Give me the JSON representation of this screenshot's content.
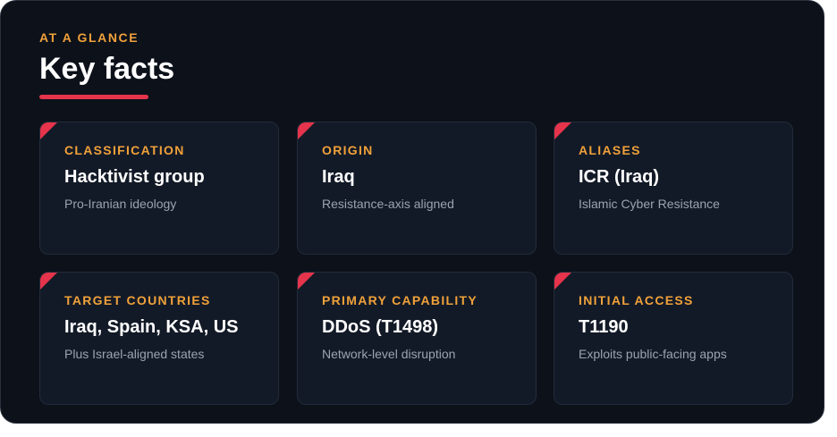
{
  "header": {
    "eyebrow": "AT A GLANCE",
    "title": "Key facts"
  },
  "colors": {
    "accent_orange": "#f0a13a",
    "accent_red": "#e5344b",
    "background": "#0c111a",
    "card": "#131a27"
  },
  "cards": [
    {
      "label": "CLASSIFICATION",
      "value": "Hacktivist group",
      "sub": "Pro-Iranian ideology"
    },
    {
      "label": "ORIGIN",
      "value": "Iraq",
      "sub": "Resistance-axis aligned"
    },
    {
      "label": "ALIASES",
      "value": "ICR (Iraq)",
      "sub": "Islamic Cyber Resistance"
    },
    {
      "label": "TARGET COUNTRIES",
      "value": "Iraq, Spain, KSA, US",
      "sub": "Plus Israel-aligned states"
    },
    {
      "label": "PRIMARY CAPABILITY",
      "value": "DDoS (T1498)",
      "sub": "Network-level disruption"
    },
    {
      "label": "INITIAL ACCESS",
      "value": "T1190",
      "sub": "Exploits public-facing apps"
    }
  ]
}
